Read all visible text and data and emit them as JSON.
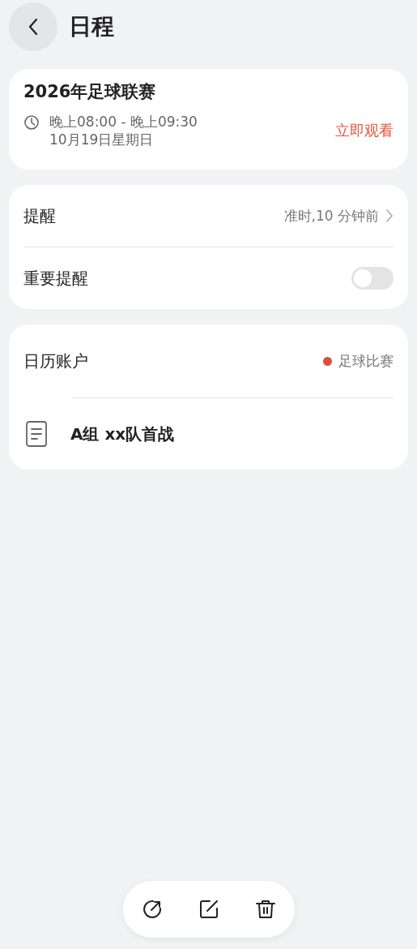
{
  "header": {
    "title": "日程"
  },
  "event": {
    "title": "2026年足球联赛",
    "time": "晚上08:00 - 晚上09:30",
    "date": "10月19日星期日",
    "action": "立即观看"
  },
  "reminder": {
    "label": "提醒",
    "value": "准时,10 分钟前"
  },
  "important_reminder": {
    "label": "重要提醒",
    "on": false
  },
  "calendar_account": {
    "label": "日历账户",
    "value": "足球比赛",
    "color": "#d9503c"
  },
  "note": {
    "text": "A组 xx队首战"
  }
}
